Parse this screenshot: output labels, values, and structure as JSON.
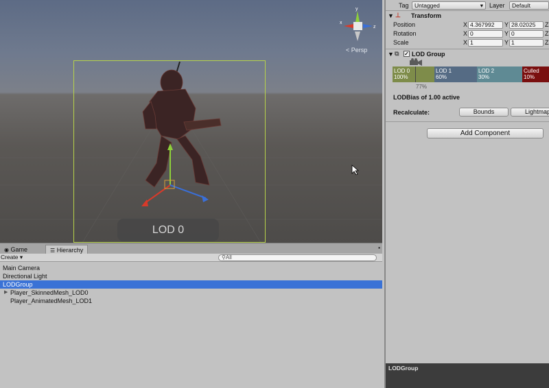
{
  "scene": {
    "view_mode": "< Persp",
    "lod_label": "LOD 0",
    "gizmo_axes": [
      "y",
      "x",
      "z"
    ]
  },
  "inspector": {
    "tag_label": "Tag",
    "tag_value": "Untagged",
    "layer_label": "Layer",
    "layer_value": "Default",
    "transform": {
      "title": "Transform",
      "position_label": "Position",
      "position": {
        "x": "4.367992",
        "y": "28.02025"
      },
      "rotation_label": "Rotation",
      "rotation": {
        "x": "0",
        "y": "0"
      },
      "scale_label": "Scale",
      "scale": {
        "x": "1",
        "y": "1"
      },
      "x_axis": "X",
      "y_axis": "Y",
      "z_axis": "Z"
    },
    "lod_group": {
      "title": "LOD Group",
      "segments": [
        {
          "name": "LOD 0",
          "percent": "100%",
          "color": "#7e8c4a"
        },
        {
          "name": "LOD 1",
          "percent": "60%",
          "color": "#556b84"
        },
        {
          "name": "LOD 2",
          "percent": "30%",
          "color": "#5f8a94"
        },
        {
          "name": "Culled",
          "percent": "10%",
          "color": "#7a0f0f"
        }
      ],
      "camera_percent": "77%",
      "lod_bias": "LODBias of 1.00 active",
      "recalculate_label": "Recalculate:",
      "bounds_button": "Bounds",
      "lightmap_button": "Lightmap"
    },
    "add_component": "Add Component"
  },
  "console": {
    "title": "LODGroup"
  },
  "hierarchy": {
    "tabs": [
      {
        "label": "Game",
        "active": false
      },
      {
        "label": "Hierarchy",
        "active": true
      }
    ],
    "create_label": "Create",
    "search_placeholder": "All",
    "items": [
      {
        "label": "Main Camera",
        "indent": 0,
        "selected": false,
        "expandable": false
      },
      {
        "label": "Directional Light",
        "indent": 0,
        "selected": false,
        "expandable": false
      },
      {
        "label": "LODGroup",
        "indent": 0,
        "selected": true,
        "expandable": false
      },
      {
        "label": "Player_SkinnedMesh_LOD0",
        "indent": 1,
        "selected": false,
        "expandable": true
      },
      {
        "label": "Player_AnimatedMesh_LOD1",
        "indent": 1,
        "selected": false,
        "expandable": false
      }
    ]
  },
  "colors": {
    "selection": "#3a72d6",
    "lod_box": "#b7d24a",
    "x_axis": "#d83a2a",
    "y_axis": "#8ed03a",
    "z_axis": "#3a6fd8"
  }
}
